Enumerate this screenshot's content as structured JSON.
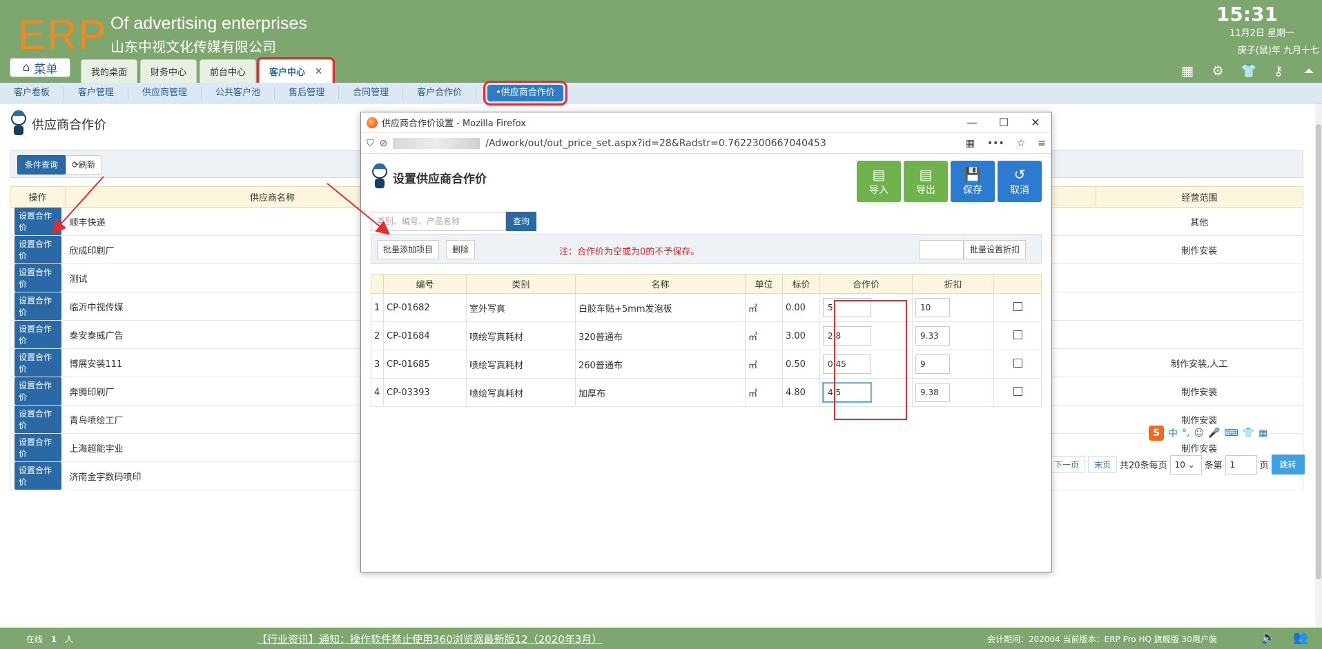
{
  "header": {
    "logo": "ERP",
    "company_en": "Of advertising enterprises",
    "company_cn": "山东中视文化传媒有限公司",
    "time": "15:31",
    "date": "11月2日 星期一",
    "lunar": "庚子(鼠)年 九月十七",
    "menu_label": "菜单",
    "tabs": [
      {
        "label": "我的桌面"
      },
      {
        "label": "财务中心"
      },
      {
        "label": "前台中心"
      },
      {
        "label": "客户中心",
        "close": "×"
      }
    ],
    "icons": [
      "grid-icon",
      "gear-icon",
      "shirt-icon",
      "key-icon",
      "arrow-up-icon"
    ]
  },
  "subnav": {
    "items": [
      "客户看板",
      "客户管理",
      "供应商管理",
      "公共客户池",
      "售后管理",
      "合同管理",
      "客户合作价"
    ],
    "active": "•供应商合作价"
  },
  "main": {
    "title": "供应商合作价",
    "query_label": "条件查询",
    "refresh_label": "刷新",
    "columns": {
      "op": "操作",
      "name": "供应商名称",
      "scope": "经营范围"
    },
    "set_label": "设置合作价",
    "rows": [
      {
        "name": "顺丰快递",
        "scope": "其他"
      },
      {
        "name": "欣成印刷厂",
        "scope": "制作安装"
      },
      {
        "name": "测试",
        "scope": ""
      },
      {
        "name": "临沂中视传媒",
        "scope": ""
      },
      {
        "name": "泰安泰威广告",
        "scope": ""
      },
      {
        "name": "博展安装111",
        "scope": "制作安装,人工"
      },
      {
        "name": "奔腾印刷厂",
        "scope": "制作安装"
      },
      {
        "name": "青鸟喷绘工厂",
        "scope": "制作安装"
      },
      {
        "name": "上海超能宇业",
        "scope": "制作安装"
      },
      {
        "name": "济南金宇数码喷印",
        "scope": ""
      }
    ],
    "pager": {
      "next": "下一页",
      "last": "末页",
      "total": "共20条每页",
      "per_page": "10",
      "unit": "条第",
      "page": "1",
      "page_unit": "页",
      "go": "跳转"
    }
  },
  "ime": {
    "logo": "S",
    "items": [
      "中",
      "°,",
      "☺",
      "🎤",
      "⌨",
      "👕",
      "▦"
    ]
  },
  "popup": {
    "window_title": "供应商合作价设置 - Mozilla Firefox",
    "url": "/Adwork/out/out_price_set.aspx?id=28&Radstr=0.7622300667040453",
    "title": "设置供应商合作价",
    "buttons": {
      "import": "导入",
      "export": "导出",
      "save": "保存",
      "cancel": "取消"
    },
    "search_placeholder": "类别、编号、产品名称",
    "search_btn": "查询",
    "batch_add": "批量添加项目",
    "delete": "删除",
    "note": "注：合作价为空或为0的不予保存。",
    "batch_discount": "批量设置折扣",
    "columns": [
      "编号",
      "类别",
      "名称",
      "单位",
      "标价",
      "合作价",
      "折扣"
    ],
    "rows": [
      {
        "no": "1",
        "code": "CP-01682",
        "category": "室外写真",
        "name": "白胶车贴+5mm发泡板",
        "unit": "㎡",
        "price": "0.00",
        "coop": "5",
        "discount": "10"
      },
      {
        "no": "2",
        "code": "CP-01684",
        "category": "喷绘写真耗材",
        "name": "320普通布",
        "unit": "㎡",
        "price": "3.00",
        "coop": "2.8",
        "discount": "9.33"
      },
      {
        "no": "3",
        "code": "CP-01685",
        "category": "喷绘写真耗材",
        "name": "260普通布",
        "unit": "㎡",
        "price": "0.50",
        "coop": "0.45",
        "discount": "9"
      },
      {
        "no": "4",
        "code": "CP-03393",
        "category": "喷绘写真耗材",
        "name": "加厚布",
        "unit": "㎡",
        "price": "4.80",
        "coop": "4.5",
        "discount": "9.38"
      }
    ]
  },
  "footer": {
    "online": "在线",
    "online_count": "1",
    "online_unit": "人",
    "notice": "【行业资讯】通知：操作软件禁止使用360浏览器最新版12（2020年3月）",
    "version": "会计期间：202004 当前版本：ERP Pro HQ 旗舰版 30用户装"
  },
  "colors": {
    "header_green": "#7da76e",
    "accent_blue": "#2b69a6",
    "highlight_red": "#e52b2b",
    "logo_orange": "#f08a1c"
  }
}
